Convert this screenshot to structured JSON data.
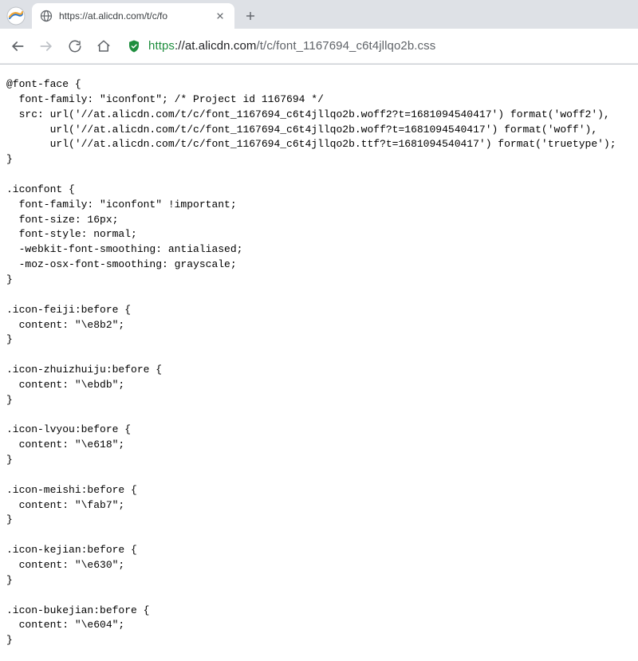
{
  "tab": {
    "title": "https://at.alicdn.com/t/c/fo"
  },
  "url": {
    "scheme": "https",
    "host": "://at.alicdn.com",
    "path": "/t/c/font_1167694_c6t4jllqo2b.css"
  },
  "css_source": "@font-face {\n  font-family: \"iconfont\"; /* Project id 1167694 */\n  src: url('//at.alicdn.com/t/c/font_1167694_c6t4jllqo2b.woff2?t=1681094540417') format('woff2'),\n       url('//at.alicdn.com/t/c/font_1167694_c6t4jllqo2b.woff?t=1681094540417') format('woff'),\n       url('//at.alicdn.com/t/c/font_1167694_c6t4jllqo2b.ttf?t=1681094540417') format('truetype');\n}\n\n.iconfont {\n  font-family: \"iconfont\" !important;\n  font-size: 16px;\n  font-style: normal;\n  -webkit-font-smoothing: antialiased;\n  -moz-osx-font-smoothing: grayscale;\n}\n\n.icon-feiji:before {\n  content: \"\\e8b2\";\n}\n\n.icon-zhuizhuiju:before {\n  content: \"\\ebdb\";\n}\n\n.icon-lvyou:before {\n  content: \"\\e618\";\n}\n\n.icon-meishi:before {\n  content: \"\\fab7\";\n}\n\n.icon-kejian:before {\n  content: \"\\e630\";\n}\n\n.icon-bukejian:before {\n  content: \"\\e604\";\n}"
}
